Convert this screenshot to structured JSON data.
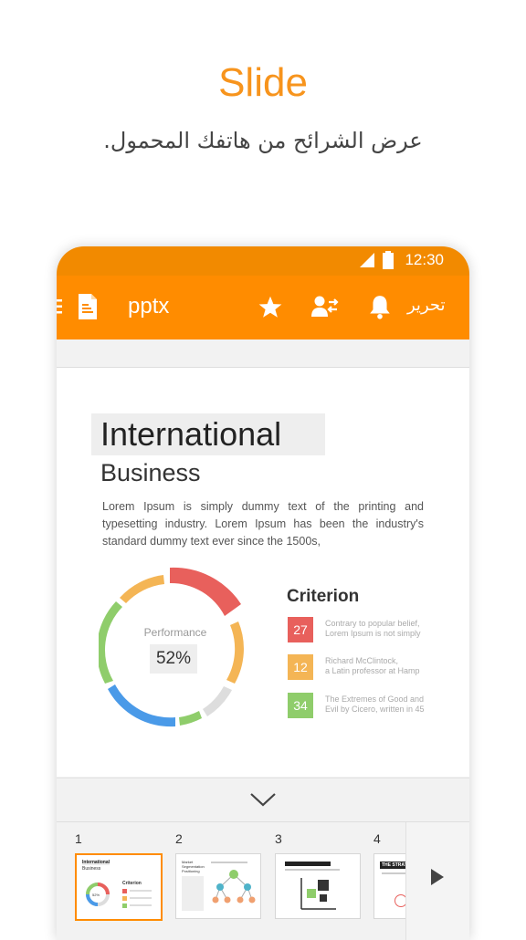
{
  "hero": {
    "title": "Slide",
    "subtitle": "عرض الشرائح من هاتفك المحمول."
  },
  "status_bar": {
    "time": "12:30",
    "icons": [
      "signal-icon",
      "battery-icon"
    ]
  },
  "toolbar": {
    "file_name": "pptx",
    "edit_label": "تحرير",
    "icons": [
      "menu-icon",
      "document-icon",
      "star-icon",
      "share-user-icon",
      "bell-icon"
    ]
  },
  "slide": {
    "title": "International",
    "subtitle": "Business",
    "body": "Lorem Ipsum is simply dummy text of the printing and typesetting industry. Lorem Ipsum has been the industry's standard dummy text ever since the 1500s,",
    "performance_label": "Performance",
    "performance_value": "52%",
    "criterion_title": "Criterion",
    "criteria": [
      {
        "value": "27",
        "line1": "Contrary to popular belief,",
        "line2": "Lorem Ipsum is  not simply",
        "color": "#e8605c"
      },
      {
        "value": "12",
        "line1": "Richard McClintock,",
        "line2": "a Latin professor at Hamp",
        "color": "#f4b555"
      },
      {
        "value": "34",
        "line1": "The Extremes of Good and",
        "line2": "Evil by Cicero, written in 45",
        "color": "#8fcd6b"
      }
    ],
    "donut_colors": [
      "#e8605c",
      "#f4b555",
      "#dddddd",
      "#8fcd6b",
      "#4a9ae8",
      "#8fcd6b",
      "#f4b555"
    ]
  },
  "thumbnails": {
    "numbers": [
      "1",
      "2",
      "3",
      "4"
    ],
    "selected": 1,
    "slide1": {
      "title": "International",
      "subtitle": "Business",
      "criterion": "Criterion",
      "value": "52%"
    },
    "slide2": {
      "title": "Market Segmentation Positioning"
    },
    "slide4": {
      "title": "THE STRATE"
    }
  },
  "colors": {
    "accent": "#ff8c00",
    "status_bar": "#f28a00",
    "hero_title": "#f7941d"
  }
}
